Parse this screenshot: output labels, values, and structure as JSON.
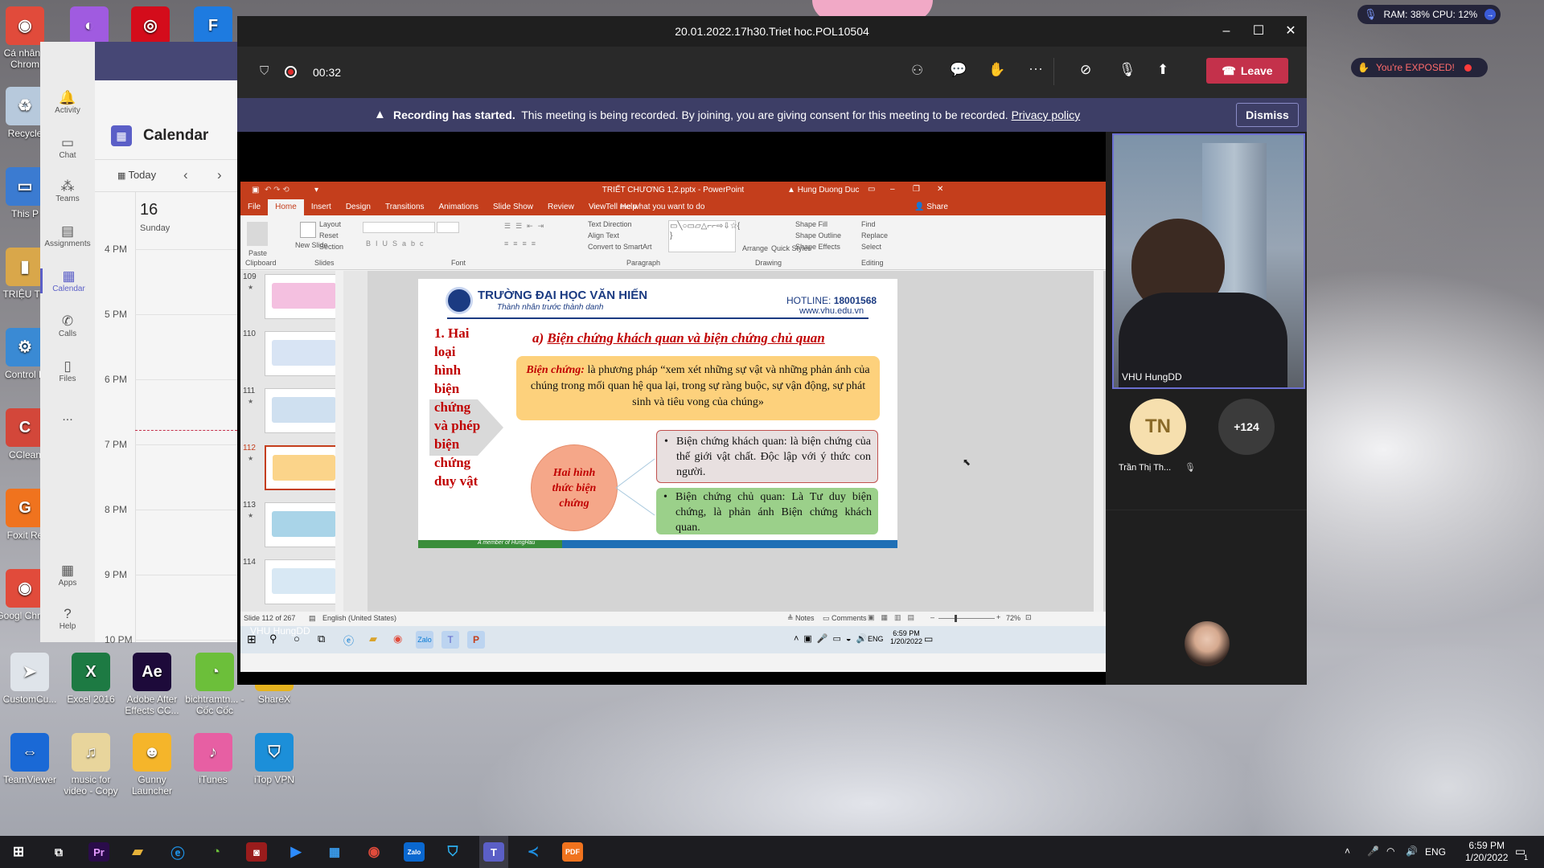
{
  "desktop": {
    "icons": [
      {
        "label": "Cá nhân - Chrom",
        "color": "#e14b3b",
        "glyph": "◉"
      },
      {
        "label": "",
        "color": "#a05be0",
        "glyph": "◐"
      },
      {
        "label": "",
        "color": "#d40c1b",
        "glyph": "◎"
      },
      {
        "label": "",
        "color": "#1e7be0",
        "glyph": "F"
      },
      {
        "label": "Recycle",
        "color": "#b7c9dc",
        "glyph": "♻"
      },
      {
        "label": "This P",
        "color": "#3b7bd1",
        "glyph": "▭"
      },
      {
        "label": "TRIỆU TR",
        "color": "#d9a74a",
        "glyph": "▮"
      },
      {
        "label": "Control P",
        "color": "#3a8ad4",
        "glyph": "⚙"
      },
      {
        "label": "CClean",
        "color": "#d3473a",
        "glyph": "C"
      },
      {
        "label": "Foxit Re",
        "color": "#f0731e",
        "glyph": "G"
      },
      {
        "label": "Googl Chrom",
        "color": "#e14b3b",
        "glyph": "◉"
      },
      {
        "label": "CustomCu...",
        "color": "#dfe4ea",
        "glyph": "➤"
      },
      {
        "label": "Excel 2016",
        "color": "#1d7a43",
        "glyph": "X"
      },
      {
        "label": "Adobe After Effects CC...",
        "color": "#1d0a3a",
        "glyph": "Ae"
      },
      {
        "label": "bichtramtn... - Cốc Cốc",
        "color": "#6cbf3a",
        "glyph": "◔"
      },
      {
        "label": "ShareX",
        "color": "#e4b21f",
        "glyph": "✺"
      },
      {
        "label": "TeamViewer",
        "color": "#1a69d6",
        "glyph": "⇔"
      },
      {
        "label": "music for video - Copy",
        "color": "#e8d59c",
        "glyph": "♫"
      },
      {
        "label": "Gunny Launcher",
        "color": "#f5b52a",
        "glyph": "☻"
      },
      {
        "label": "iTunes",
        "color": "#e75fa3",
        "glyph": "♪"
      },
      {
        "label": "iTop VPN",
        "color": "#1c8fd9",
        "glyph": "⛉"
      }
    ]
  },
  "overlays": {
    "ram_cpu": "RAM: 38% CPU: 12%",
    "exposed": "You're EXPOSED!"
  },
  "teams": {
    "rail": [
      {
        "label": "Activity",
        "glyph": "🔔"
      },
      {
        "label": "Chat",
        "glyph": "▭"
      },
      {
        "label": "Teams",
        "glyph": "⁂"
      },
      {
        "label": "Assignments",
        "glyph": "▤"
      },
      {
        "label": "Calendar",
        "glyph": "▦"
      },
      {
        "label": "Calls",
        "glyph": "✆"
      },
      {
        "label": "Files",
        "glyph": "▯"
      },
      {
        "label": "...",
        "glyph": ""
      },
      {
        "label": "Apps",
        "glyph": "▦"
      },
      {
        "label": "Help",
        "glyph": "?"
      }
    ],
    "calendar_title": "Calendar",
    "today_label": "Today",
    "day_number": "16",
    "day_name": "Sunday",
    "hours": [
      "4 PM",
      "5 PM",
      "6 PM",
      "7 PM",
      "8 PM",
      "9 PM",
      "10 PM"
    ]
  },
  "meeting": {
    "title": "20.01.2022.17h30.Triet hoc.POL10504",
    "timer": "00:32",
    "leave_label": "Leave",
    "banner_bold": "Recording has started.",
    "banner_text": "This meeting is being recorded. By joining, you are giving consent for this meeting to be recorded.",
    "banner_link": "Privacy policy",
    "dismiss_label": "Dismiss",
    "sharer_name": "VHU HungDD",
    "video_name": "VHU HungDD",
    "participant_initials": "TN",
    "participant_name": "Trần Thị Th...",
    "more_count": "+124"
  },
  "powerpoint": {
    "title": "TRIẾT CHƯƠNG 1,2.pptx - PowerPoint",
    "user": "Hung Duong Duc",
    "tabs": [
      "File",
      "Home",
      "Insert",
      "Design",
      "Transitions",
      "Animations",
      "Slide Show",
      "Review",
      "View",
      "Help"
    ],
    "tell_me": "Tell me what you want to do",
    "share_label": "Share",
    "ribbon_groups": [
      "Clipboard",
      "Slides",
      "Font",
      "Paragraph",
      "Drawing",
      "Editing"
    ],
    "ribbon_items": {
      "paste": "Paste",
      "new_slide": "New Slide",
      "layout": "Layout",
      "reset": "Reset",
      "section": "Section",
      "text_direction": "Text Direction",
      "align_text": "Align Text",
      "convert_smartart": "Convert to SmartArt",
      "arrange": "Arrange",
      "quick_styles": "Quick Styles",
      "shape_fill": "Shape Fill",
      "shape_outline": "Shape Outline",
      "shape_effects": "Shape Effects",
      "find": "Find",
      "replace": "Replace",
      "select": "Select"
    },
    "thumbs": [
      {
        "num": "109",
        "star": "★"
      },
      {
        "num": "110",
        "star": ""
      },
      {
        "num": "111",
        "star": "★"
      },
      {
        "num": "112",
        "star": "★"
      },
      {
        "num": "113",
        "star": "★"
      },
      {
        "num": "114",
        "star": ""
      }
    ],
    "status_slide": "Slide 112 of 267",
    "status_lang": "English (United States)",
    "notes": "Notes",
    "comments": "Comments",
    "zoom": "72%",
    "inner_clock_time": "6:59 PM",
    "inner_clock_date": "1/20/2022",
    "inner_lang": "ENG"
  },
  "slide": {
    "school": "TRƯỜNG ĐẠI HỌC VĂN HIẾN",
    "motto": "Thành nhân trước thành danh",
    "hotline_label": "HOTLINE:",
    "hotline_number": "18001568",
    "website": "www.vhu.edu.vn",
    "left_heading": "1. Hai loại hình biện chứng và phép biện chứng duy vật",
    "section_title_prefix": "a)",
    "section_title": "Biện chứng khách quan và biện chứng chủ quan",
    "definition_term": "Biện chứng:",
    "definition_text": "là phương pháp “xem xét những sự vật và những phản ánh của chúng trong mối quan hệ qua lại, trong sự ràng buộc, sự vận động, sự phát sinh và tiêu vong của chúng»",
    "circle_text": "Hai hình thức biện chứng",
    "bullet_1": "Biện chứng khách quan: là biện chứng của thế giới vật chất. Độc lập với ý thức con người.",
    "bullet_2": "Biện chứng chủ quan: Là Tư duy biện chứng, là phản ánh Biện chứng khách quan.",
    "footer": "A member of HungHau"
  },
  "taskbar": {
    "time": "6:59 PM",
    "date": "1/20/2022",
    "lang": "ENG",
    "notif_count": "1"
  },
  "colors": {
    "teams_purple": "#464775",
    "leave_red": "#c4314b",
    "ppt_red": "#c43e1c",
    "slide_title_red": "#c00000"
  }
}
